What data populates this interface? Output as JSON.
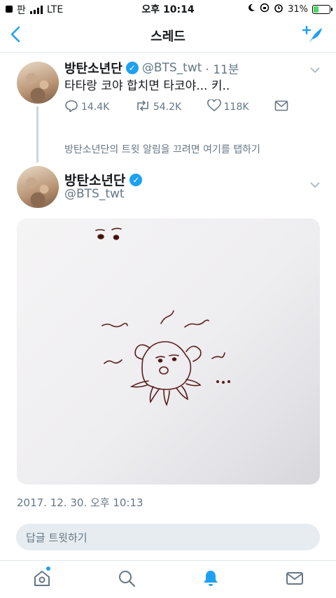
{
  "status_bar": {
    "carrier": "판",
    "network": "LTE",
    "time": "오후 10:14",
    "battery_percent": "31%",
    "battery_level": 0.31
  },
  "navbar": {
    "title": "스레드",
    "accent_color": "#1da1f2"
  },
  "tweet1": {
    "name": "방탄소년단",
    "handle": "@BTS_twt",
    "time_ago": "· 11분",
    "text": "타타랑 코야 합치면 타코야... 키..",
    "replies": "14.4K",
    "retweets": "54.2K",
    "likes": "118K"
  },
  "notification_link": "방탄소년단의 트윗 알림을 끄려면 여기를 탭하기",
  "tweet2": {
    "name": "방탄소년단",
    "handle": "@BTS_twt",
    "timestamp": "2017. 12. 30. 오후 10:13"
  },
  "reply_box": {
    "placeholder": "답글 트윗하기"
  },
  "tab_bar": {
    "items": [
      "home-icon",
      "search-icon",
      "notifications-icon",
      "messages-icon"
    ],
    "active": "notifications-icon"
  }
}
